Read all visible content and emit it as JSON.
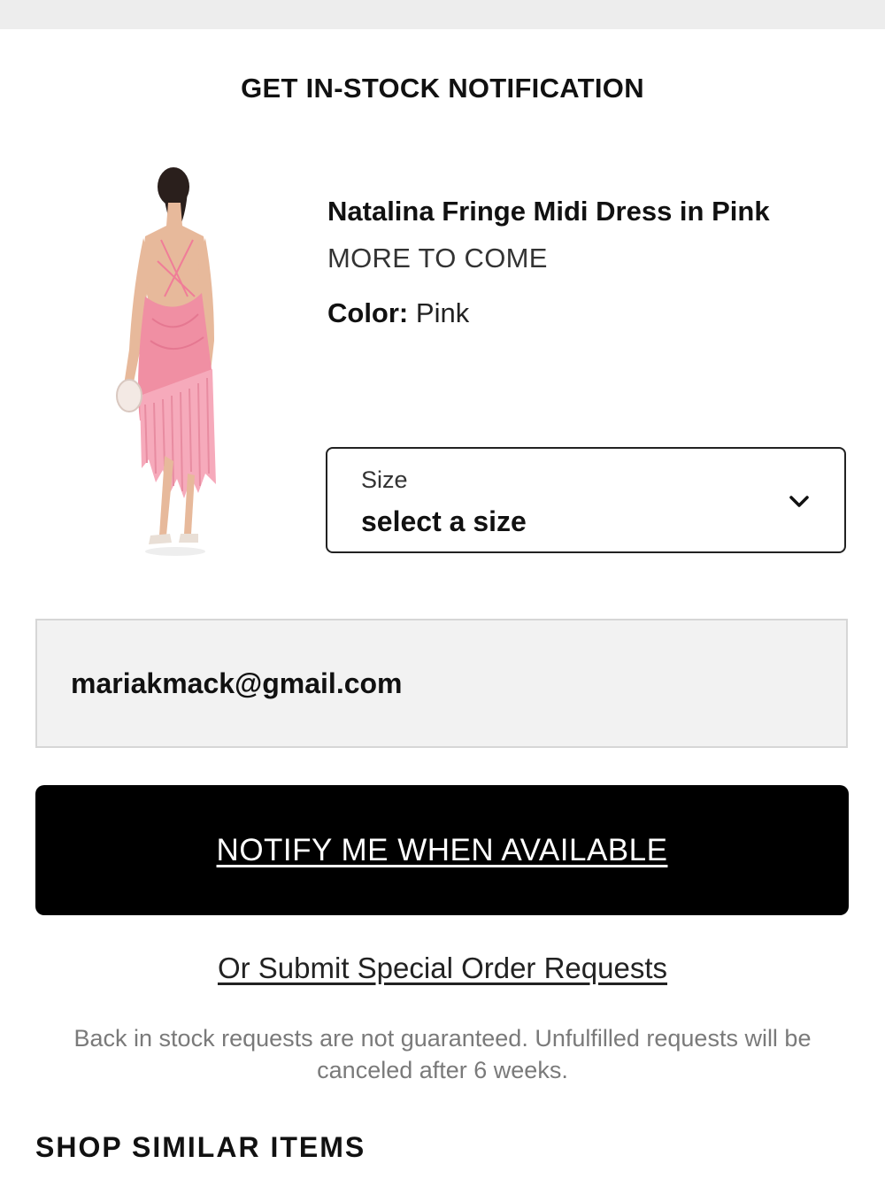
{
  "modal": {
    "title": "GET IN-STOCK NOTIFICATION"
  },
  "product": {
    "name": "Natalina Fringe Midi Dress in Pink",
    "status": "MORE TO COME",
    "color_label": "Color:",
    "color_value": "Pink",
    "image_icon": "product-photo-dress"
  },
  "size_select": {
    "label": "Size",
    "value": "select a size",
    "icon": "chevron-down-icon"
  },
  "email": {
    "value": "mariakmack@gmail.com"
  },
  "actions": {
    "notify_label": "NOTIFY ME WHEN AVAILABLE",
    "special_order_label": "Or Submit Special Order Requests"
  },
  "disclaimer": {
    "text": "Back in stock requests are not guaranteed. Unfulfilled requests will be canceled after 6 weeks."
  },
  "similar": {
    "heading": "SHOP SIMILAR ITEMS"
  },
  "colors": {
    "top_bar": "#ededed",
    "button_bg": "#000000",
    "button_text": "#ffffff",
    "field_bg": "#f2f2f2",
    "dress_pink": "#f08fa3"
  }
}
